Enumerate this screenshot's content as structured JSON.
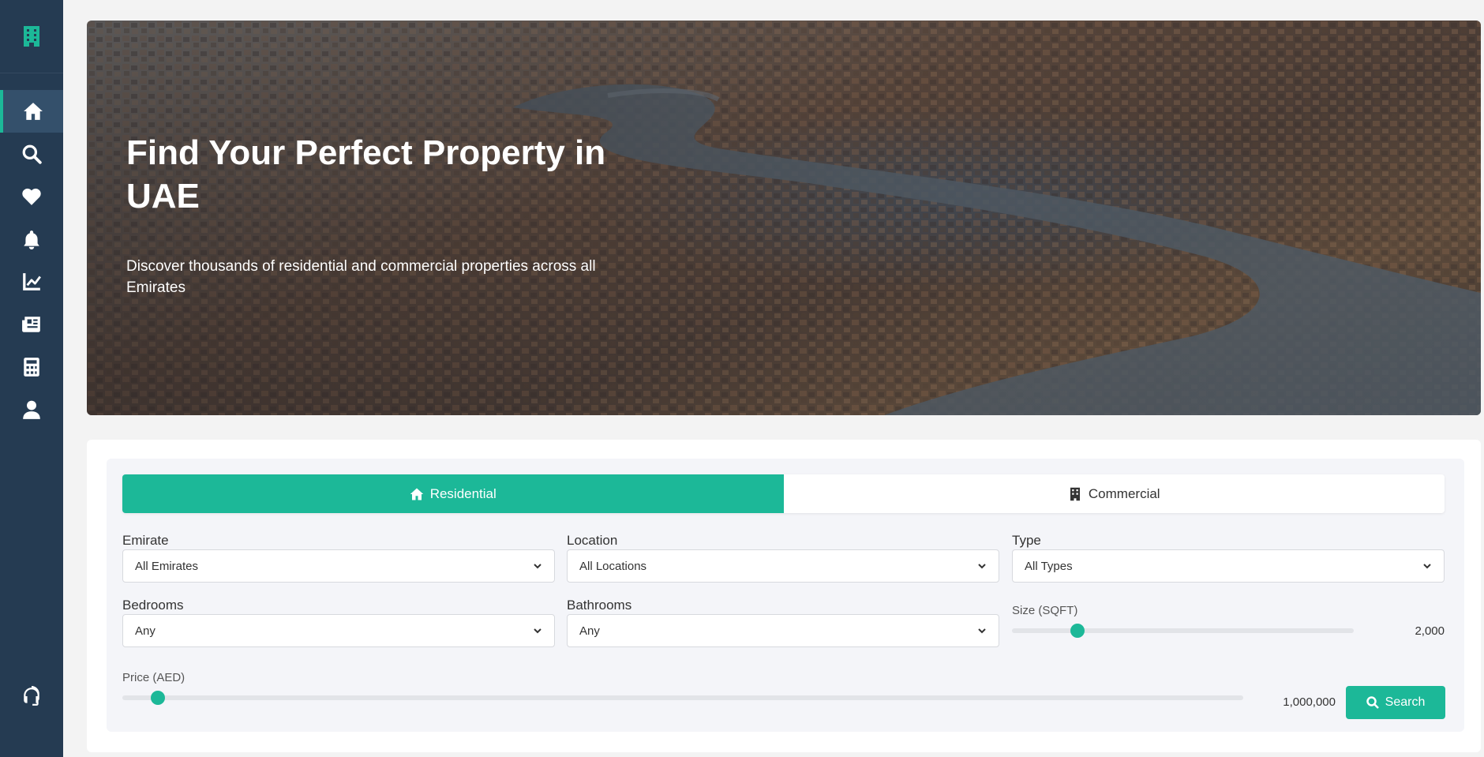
{
  "sidebar": {
    "logo_icon": "building-icon",
    "items": [
      {
        "name": "home",
        "icon": "home-icon",
        "active": true
      },
      {
        "name": "search",
        "icon": "search-icon"
      },
      {
        "name": "favorites",
        "icon": "heart-icon"
      },
      {
        "name": "notifications",
        "icon": "bell-icon"
      },
      {
        "name": "analytics",
        "icon": "chart-line-icon"
      },
      {
        "name": "news",
        "icon": "newspaper-icon"
      },
      {
        "name": "calculator",
        "icon": "calculator-icon"
      },
      {
        "name": "profile",
        "icon": "user-icon"
      }
    ],
    "support_icon": "headset-icon"
  },
  "hero": {
    "title": "Find Your Perfect Property in UAE",
    "subtitle": "Discover thousands of residential and commercial properties across all Emirates"
  },
  "search": {
    "tabs": [
      {
        "label": "Residential",
        "icon": "home-icon",
        "active": true
      },
      {
        "label": "Commercial",
        "icon": "building-icon",
        "active": false
      }
    ],
    "emirate": {
      "label": "Emirate",
      "value": "All Emirates"
    },
    "location": {
      "label": "Location",
      "value": "All Locations"
    },
    "type": {
      "label": "Type",
      "value": "All Types"
    },
    "bedrooms": {
      "label": "Bedrooms",
      "value": "Any"
    },
    "bathrooms": {
      "label": "Bathrooms",
      "value": "Any"
    },
    "size": {
      "label": "Size (SQFT)",
      "value": "2,000",
      "level": 0.17
    },
    "price": {
      "label": "Price (AED)",
      "value": "1,000,000",
      "level": 0.025
    },
    "button_label": "Search"
  },
  "colors": {
    "accent": "#1cb898",
    "sidebar": "#253b52"
  }
}
